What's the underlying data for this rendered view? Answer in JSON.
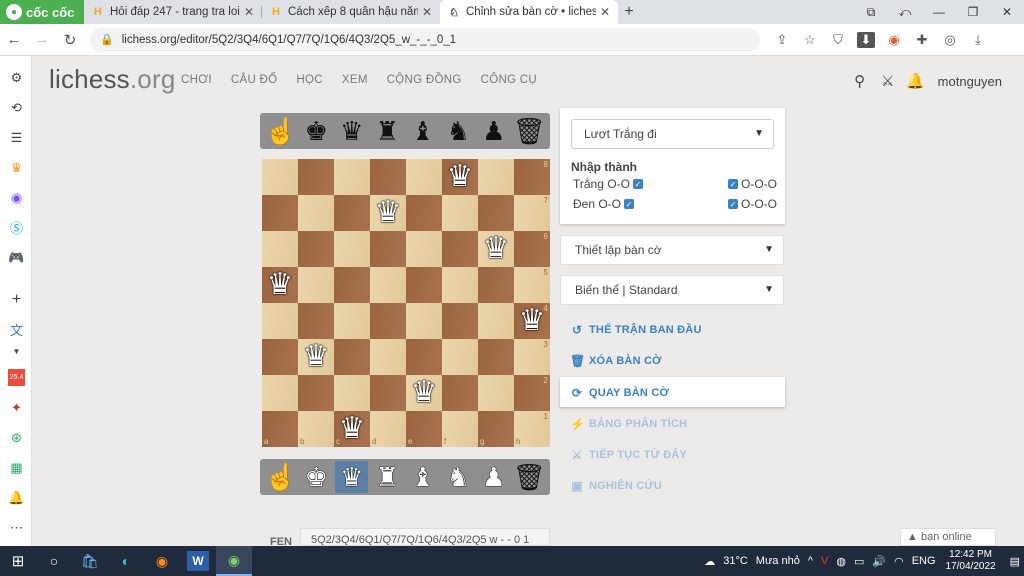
{
  "browser": {
    "brand": "cốc cốc",
    "tabs": [
      {
        "title": "Hỏi đáp 247 - trang tra loi",
        "favicon": "H"
      },
      {
        "title": "Cách xếp 8 quân hậu nằm tre",
        "favicon": "H"
      },
      {
        "title": "Chỉnh sửa bàn cờ • lichess.or",
        "favicon": "lichess"
      }
    ],
    "url": "lichess.org/editor/5Q2/3Q4/6Q1/Q7/7Q/1Q6/4Q3/2Q5_w_-_-_0_1"
  },
  "site": {
    "logo_main": "lichess",
    "logo_tld": ".org",
    "nav": [
      "CHƠI",
      "CÂU ĐỐ",
      "HỌC",
      "XEM",
      "CỘNG ĐỒNG",
      "CÔNG CỤ"
    ],
    "username": "motnguyen"
  },
  "editor": {
    "turn_select": "Lượt Trắng đi",
    "castling": {
      "title": "Nhập thành",
      "white_label": "Trắng O-O",
      "black_label": "Đen O-O",
      "long": "O-O-O"
    },
    "setup_select": "Thiết lập bàn cờ",
    "variant_select": "Biến thể | Standard",
    "actions": [
      {
        "label": "THẾ TRẬN BAN ĐẦU",
        "icon": "reset-icon"
      },
      {
        "label": "XÓA BÀN CỜ",
        "icon": "trash-icon"
      },
      {
        "label": "QUAY BÀN CỜ",
        "icon": "rotate-icon"
      },
      {
        "label": "BẢNG PHÂN TÍCH",
        "icon": "analysis-icon"
      },
      {
        "label": "TIẾP TỤC TỪ ĐÂY",
        "icon": "continue-icon"
      },
      {
        "label": "NGHIÊN CỨU",
        "icon": "study-icon"
      }
    ],
    "fen_label": "FEN",
    "fen": "5Q2/3Q4/6Q1/Q7/7Q/1Q6/4Q3/2Q5 w - - 0 1",
    "files": [
      "a",
      "b",
      "c",
      "d",
      "e",
      "f",
      "g",
      "h"
    ],
    "ranks": [
      "8",
      "7",
      "6",
      "5",
      "4",
      "3",
      "2",
      "1"
    ],
    "queens": [
      "f8",
      "d7",
      "g6",
      "a5",
      "h4",
      "b3",
      "e2",
      "c1"
    ]
  },
  "online": "bạn online",
  "taskbar": {
    "weather": "31°C",
    "weather_desc": "Mưa nhỏ",
    "lang": "ENG",
    "time": "12:42 PM",
    "date": "17/04/2022"
  }
}
